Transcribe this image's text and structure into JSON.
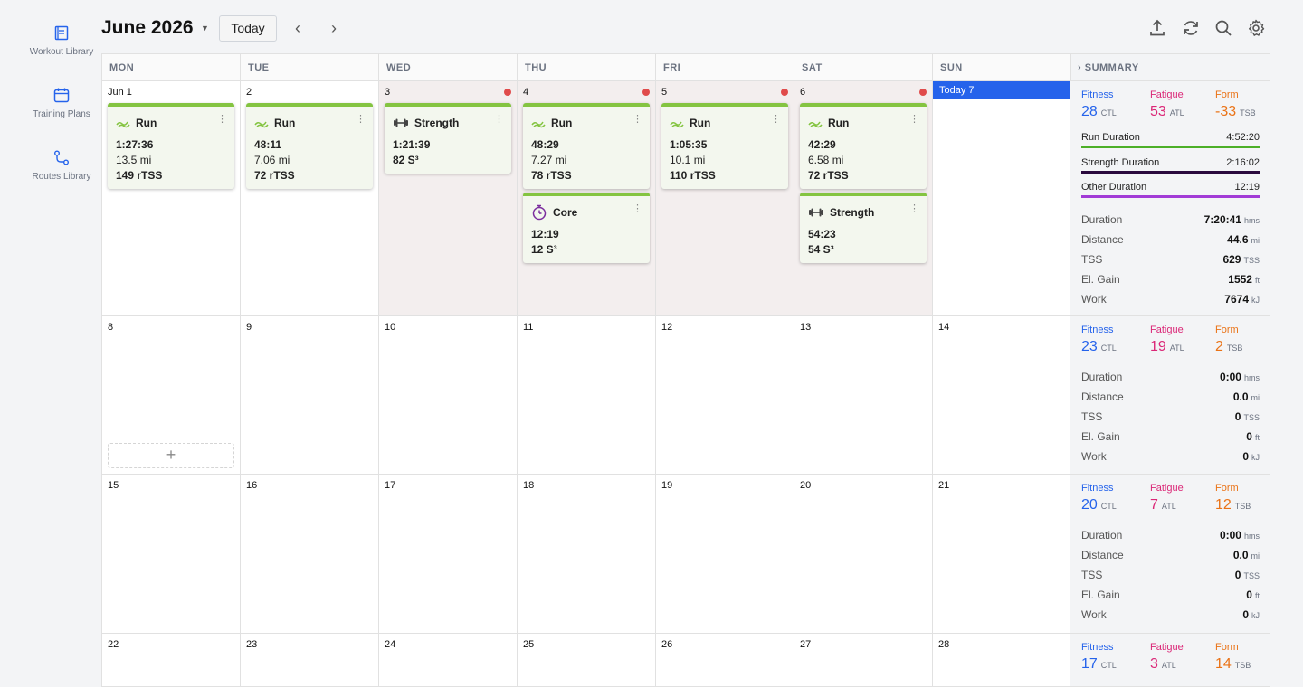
{
  "rail": [
    {
      "label": "Workout Library",
      "icon": "book-icon"
    },
    {
      "label": "Training Plans",
      "icon": "calendar-icon"
    },
    {
      "label": "Routes Library",
      "icon": "route-icon"
    }
  ],
  "header": {
    "title": "June 2026",
    "today_label": "Today",
    "prev": "‹",
    "next": "›"
  },
  "weekdays": [
    "MON",
    "TUE",
    "WED",
    "THU",
    "FRI",
    "SAT",
    "SUN"
  ],
  "summary_label": "SUMMARY",
  "summary_caret": "›",
  "add_symbol": "+",
  "today_label": "Today 7",
  "weeks": [
    {
      "days": [
        "Jun 1",
        "2",
        "3",
        "4",
        "5",
        "6",
        "7"
      ]
    },
    {
      "days": [
        "8",
        "9",
        "10",
        "11",
        "12",
        "13",
        "14"
      ]
    },
    {
      "days": [
        "15",
        "16",
        "17",
        "18",
        "19",
        "20",
        "21"
      ]
    },
    {
      "days": [
        "22",
        "23",
        "24",
        "25",
        "26",
        "27",
        "28"
      ]
    }
  ],
  "workouts": [
    {
      "day": 0,
      "slot": 0,
      "name": "Run",
      "icon": "run-icon",
      "lines": [
        "1:27:36",
        "13.5 mi",
        "149 rTSS"
      ]
    },
    {
      "day": 1,
      "slot": 0,
      "name": "Run",
      "icon": "run-icon",
      "lines": [
        "48:11",
        "7.06 mi",
        "72 rTSS"
      ]
    },
    {
      "day": 2,
      "slot": 0,
      "name": "Strength",
      "icon": "dumbbell-icon",
      "lines": [
        "1:21:39",
        "82 S³"
      ]
    },
    {
      "day": 3,
      "slot": 0,
      "name": "Run",
      "icon": "run-icon",
      "lines": [
        "48:29",
        "7.27 mi",
        "78 rTSS"
      ]
    },
    {
      "day": 3,
      "slot": 1,
      "name": "Core",
      "icon": "stopwatch-icon",
      "lines": [
        "12:19",
        "12 S³"
      ]
    },
    {
      "day": 4,
      "slot": 0,
      "name": "Run",
      "icon": "run-icon",
      "lines": [
        "1:05:35",
        "10.1 mi",
        "110 rTSS"
      ]
    },
    {
      "day": 5,
      "slot": 0,
      "name": "Run",
      "icon": "run-icon",
      "lines": [
        "42:29",
        "6.58 mi",
        "72 rTSS"
      ]
    },
    {
      "day": 5,
      "slot": 1,
      "name": "Strength",
      "icon": "dumbbell-icon",
      "lines": [
        "54:23",
        "54 S³"
      ]
    }
  ],
  "summaries": [
    {
      "fitness": {
        "label": "Fitness",
        "value": "28",
        "unit": "CTL"
      },
      "fatigue": {
        "label": "Fatigue",
        "value": "53",
        "unit": "ATL"
      },
      "form": {
        "label": "Form",
        "value": "-33",
        "unit": "TSB"
      },
      "durations": [
        {
          "label": "Run Duration",
          "value": "4:52:20",
          "color": "#4caf28"
        },
        {
          "label": "Strength Duration",
          "value": "2:16:02",
          "color": "#2a0a3e"
        },
        {
          "label": "Other Duration",
          "value": "12:19",
          "color": "#a23bd6"
        }
      ],
      "stats": [
        {
          "label": "Duration",
          "value": "7:20:41",
          "unit": "hms"
        },
        {
          "label": "Distance",
          "value": "44.6",
          "unit": "mi"
        },
        {
          "label": "TSS",
          "value": "629",
          "unit": "TSS"
        },
        {
          "label": "El. Gain",
          "value": "1552",
          "unit": "ft"
        },
        {
          "label": "Work",
          "value": "7674",
          "unit": "kJ"
        }
      ]
    },
    {
      "fitness": {
        "label": "Fitness",
        "value": "23",
        "unit": "CTL"
      },
      "fatigue": {
        "label": "Fatigue",
        "value": "19",
        "unit": "ATL"
      },
      "form": {
        "label": "Form",
        "value": "2",
        "unit": "TSB"
      },
      "durations": [],
      "stats": [
        {
          "label": "Duration",
          "value": "0:00",
          "unit": "hms"
        },
        {
          "label": "Distance",
          "value": "0.0",
          "unit": "mi"
        },
        {
          "label": "TSS",
          "value": "0",
          "unit": "TSS"
        },
        {
          "label": "El. Gain",
          "value": "0",
          "unit": "ft"
        },
        {
          "label": "Work",
          "value": "0",
          "unit": "kJ"
        }
      ]
    },
    {
      "fitness": {
        "label": "Fitness",
        "value": "20",
        "unit": "CTL"
      },
      "fatigue": {
        "label": "Fatigue",
        "value": "7",
        "unit": "ATL"
      },
      "form": {
        "label": "Form",
        "value": "12",
        "unit": "TSB"
      },
      "durations": [],
      "stats": [
        {
          "label": "Duration",
          "value": "0:00",
          "unit": "hms"
        },
        {
          "label": "Distance",
          "value": "0.0",
          "unit": "mi"
        },
        {
          "label": "TSS",
          "value": "0",
          "unit": "TSS"
        },
        {
          "label": "El. Gain",
          "value": "0",
          "unit": "ft"
        },
        {
          "label": "Work",
          "value": "0",
          "unit": "kJ"
        }
      ]
    },
    {
      "fitness": {
        "label": "Fitness",
        "value": "17",
        "unit": "CTL"
      },
      "fatigue": {
        "label": "Fatigue",
        "value": "3",
        "unit": "ATL"
      },
      "form": {
        "label": "Form",
        "value": "14",
        "unit": "TSB"
      },
      "durations": [],
      "stats": []
    }
  ],
  "colors": {
    "accent": "#2563eb",
    "run": "#84c441",
    "fitness": "#2563eb",
    "fatigue": "#db2777",
    "form": "#ea7317",
    "missed_dot": "#e04b4b"
  }
}
